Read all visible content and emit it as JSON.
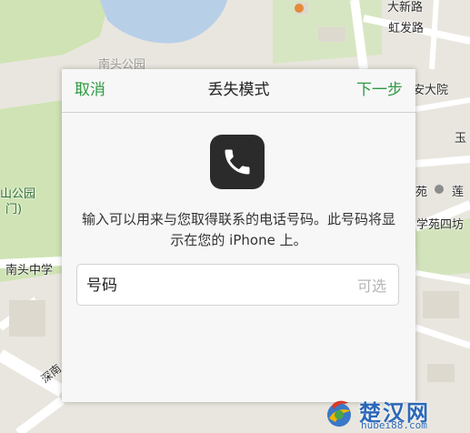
{
  "map": {
    "labels": {
      "top_right_a": "大新路",
      "top_right_b": "虹发路",
      "an_da": "安大院",
      "yu": "玉",
      "yuan": "苑",
      "lian": "莲",
      "road_four": "学苑四坊",
      "park_a": "山公园",
      "park_b": "门)",
      "school": "南头中学",
      "shennan": "深南",
      "top_faded": "南头公园"
    },
    "colors": {
      "water": "#b8cfe8",
      "green": "#cfe3b4",
      "road": "#ffffff",
      "base": "#e9e6df"
    }
  },
  "dialog": {
    "cancel_label": "取消",
    "title": "丢失模式",
    "next_label": "下一步",
    "icon": "phone-icon",
    "message": "输入可以用来与您取得联系的电话号码。此号码将显示在您的 iPhone 上。",
    "field": {
      "label": "号码",
      "value": "",
      "placeholder": "可选"
    },
    "accent_color": "#2e9a43"
  },
  "watermark": {
    "brand": "楚汉网",
    "url": "hubei88.com",
    "color": "#2b68b8"
  }
}
